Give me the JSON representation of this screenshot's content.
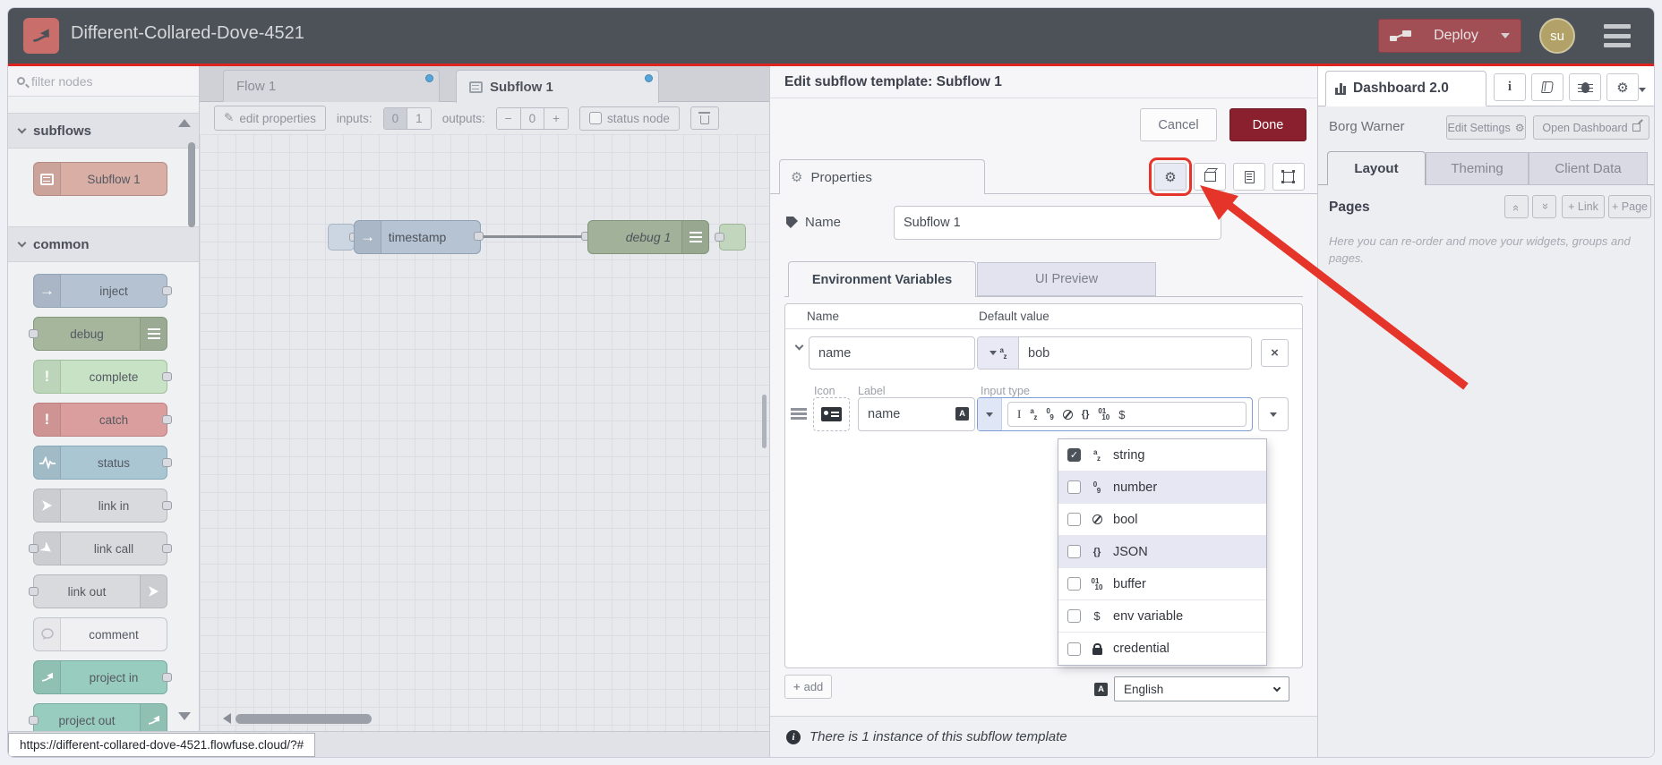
{
  "header": {
    "title": "Different-Collared-Dove-4521",
    "deploy_label": "Deploy",
    "avatar": "su"
  },
  "palette": {
    "filter_placeholder": "filter nodes",
    "subflows_label": "subflows",
    "common_label": "common",
    "subflow_node": "Subflow 1",
    "nodes": [
      {
        "label": "inject"
      },
      {
        "label": "debug"
      },
      {
        "label": "complete"
      },
      {
        "label": "catch"
      },
      {
        "label": "status"
      },
      {
        "label": "link in"
      },
      {
        "label": "link call"
      },
      {
        "label": "link out"
      },
      {
        "label": "comment"
      },
      {
        "label": "project in"
      },
      {
        "label": "project out"
      }
    ]
  },
  "workspace": {
    "tabs": [
      {
        "label": "Flow 1"
      },
      {
        "label": "Subflow 1"
      }
    ],
    "toolbar": {
      "edit_properties": "edit properties",
      "inputs_label": "inputs:",
      "input_opt_0": "0",
      "input_opt_1": "1",
      "outputs_label": "outputs:",
      "outputs_minus": "−",
      "outputs_value": "0",
      "outputs_plus": "+",
      "status_node_label": "status node"
    },
    "flow": {
      "node_in": "timestamp",
      "node_out": "debug 1"
    },
    "url_status": "https://different-collared-dove-4521.flowfuse.cloud/?#"
  },
  "dialog": {
    "title": "Edit subflow template: Subflow 1",
    "cancel_label": "Cancel",
    "done_label": "Done",
    "properties_tab": "Properties",
    "name_label": "Name",
    "name_value": "Subflow 1",
    "tab_env": "Environment Variables",
    "tab_ui": "UI Preview",
    "col_name": "Name",
    "col_default": "Default value",
    "env_name": "name",
    "env_value": "bob",
    "icon_label": "Icon",
    "label_label": "Label",
    "label_value": "name",
    "input_type_label": "Input type",
    "type_options": [
      {
        "label": "string",
        "checked": true
      },
      {
        "label": "number",
        "checked": false
      },
      {
        "label": "bool",
        "checked": false
      },
      {
        "label": "JSON",
        "checked": false
      },
      {
        "label": "buffer",
        "checked": false
      },
      {
        "label": "env variable",
        "checked": false
      },
      {
        "label": "credential",
        "checked": false
      }
    ],
    "add_label": "add",
    "language_value": "English",
    "footer_note": "There is 1 instance of this subflow template"
  },
  "sidebar": {
    "tab_label": "Dashboard 2.0",
    "instance_name": "Borg Warner",
    "edit_settings_label": "Edit Settings",
    "open_dashboard_label": "Open Dashboard",
    "tab_layout": "Layout",
    "tab_theming": "Theming",
    "tab_client": "Client Data",
    "pages_label": "Pages",
    "link_button": "+ Link",
    "page_button": "+ Page",
    "hint": "Here you can re-order and move your widgets, groups and pages."
  },
  "colors": {
    "accent_red": "#e5352b",
    "deploy_bg": "#a14e55",
    "done_bg": "#8a1f2d",
    "header_bg": "#4c5258"
  }
}
